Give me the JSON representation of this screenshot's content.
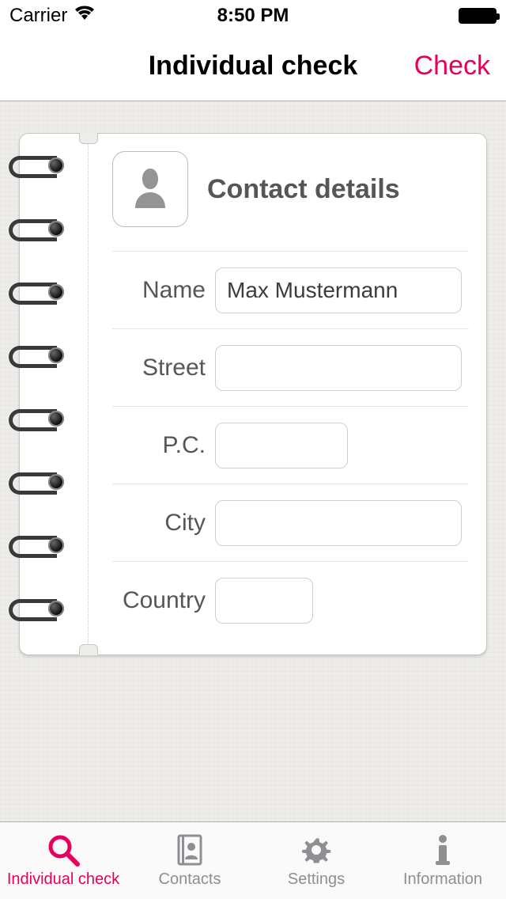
{
  "status": {
    "carrier": "Carrier",
    "time": "8:50 PM"
  },
  "nav": {
    "title": "Individual check",
    "right": "Check"
  },
  "card": {
    "section_title": "Contact details",
    "fields": {
      "name": {
        "label": "Name",
        "value": "Max Mustermann"
      },
      "street": {
        "label": "Street",
        "value": ""
      },
      "pc": {
        "label": "P.C.",
        "value": ""
      },
      "city": {
        "label": "City",
        "value": ""
      },
      "country": {
        "label": "Country",
        "value": ""
      }
    }
  },
  "tabs": {
    "individual": "Individual check",
    "contacts": "Contacts",
    "settings": "Settings",
    "information": "Information"
  }
}
